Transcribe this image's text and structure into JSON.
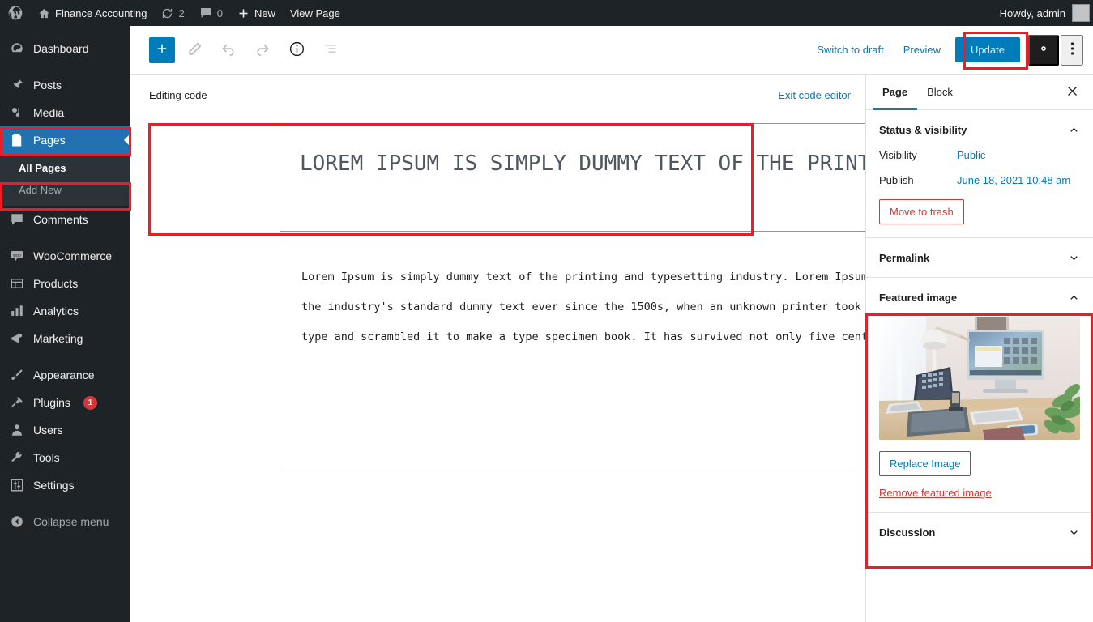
{
  "adminbar": {
    "logo_icon": "wordpress-logo-icon",
    "site_name": "Finance Accounting",
    "site_icon": "home-icon",
    "updates_icon": "updates-icon",
    "updates_count": "2",
    "comments_icon": "comment-bubble-icon",
    "comments_count": "0",
    "new_icon": "plus-icon",
    "new_label": "New",
    "view_page_label": "View Page",
    "howdy": "Howdy, admin"
  },
  "sidebar_menu": {
    "items": [
      {
        "label": "Dashboard",
        "icon": "dashboard-icon"
      },
      {
        "label": "Posts",
        "icon": "pin-icon"
      },
      {
        "label": "Media",
        "icon": "media-icon"
      },
      {
        "label": "Pages",
        "icon": "pages-icon"
      },
      {
        "label": "Comments",
        "icon": "comment-bubble-icon"
      },
      {
        "label": "WooCommerce",
        "icon": "woocommerce-icon"
      },
      {
        "label": "Products",
        "icon": "products-icon"
      },
      {
        "label": "Analytics",
        "icon": "analytics-bars-icon"
      },
      {
        "label": "Marketing",
        "icon": "megaphone-icon"
      },
      {
        "label": "Appearance",
        "icon": "paintbrush-icon"
      },
      {
        "label": "Plugins",
        "icon": "plug-icon",
        "badge": "1"
      },
      {
        "label": "Users",
        "icon": "user-icon"
      },
      {
        "label": "Tools",
        "icon": "wrench-icon"
      },
      {
        "label": "Settings",
        "icon": "sliders-icon"
      },
      {
        "label": "Collapse menu",
        "icon": "collapse-arrow-icon"
      }
    ],
    "pages_submenu": [
      {
        "label": "All Pages",
        "current": true
      },
      {
        "label": "Add New",
        "current": false
      }
    ]
  },
  "editor_header": {
    "add_block_icon": "plus-icon",
    "tools_icon": "pencil-icon",
    "undo_icon": "undo-arrow-icon",
    "redo_icon": "redo-arrow-icon",
    "details_icon": "info-circle-icon",
    "list_view_icon": "list-view-icon",
    "switch_to_draft": "Switch to draft",
    "preview": "Preview",
    "update": "Update",
    "settings_icon": "gear-icon",
    "more_icon": "three-dots-vertical-icon"
  },
  "code_editor": {
    "status_label": "Editing code",
    "exit_label": "Exit code editor",
    "title_text": "LOREM IPSUM IS SIMPLY DUMMY TEXT OF THE PRINTING",
    "body_text": "Lorem Ipsum is simply dummy text of the printing and typesetting industry. Lorem Ipsum has been the industry's standard dummy text ever since the 1500s, when an unknown printer took a galley of type and scrambled it to make a type specimen book. It has survived not only five centuries,"
  },
  "settings_panel": {
    "tabs": [
      {
        "label": "Page",
        "active": true
      },
      {
        "label": "Block",
        "active": false
      }
    ],
    "close_icon": "close-x-icon",
    "status_visibility": {
      "title": "Status & visibility",
      "chevron": "chevron-up-icon",
      "visibility_label": "Visibility",
      "visibility_value": "Public",
      "publish_label": "Publish",
      "publish_value": "June 18, 2021 10:48 am",
      "trash_label": "Move to trash"
    },
    "permalink": {
      "title": "Permalink",
      "chevron": "chevron-down-icon"
    },
    "featured_image": {
      "title": "Featured image",
      "chevron": "chevron-up-icon",
      "image_alt": "desk workspace with imac laptop lamp and plant",
      "replace_label": "Replace Image",
      "remove_label": "Remove featured image"
    },
    "discussion": {
      "title": "Discussion",
      "chevron": "chevron-down-icon"
    }
  },
  "colors": {
    "admin_dark": "#1d2327",
    "menu_current_blue": "#2271b1",
    "accent_blue": "#007cba",
    "annotation_red": "#ee1c25",
    "danger_red": "#d63638"
  }
}
